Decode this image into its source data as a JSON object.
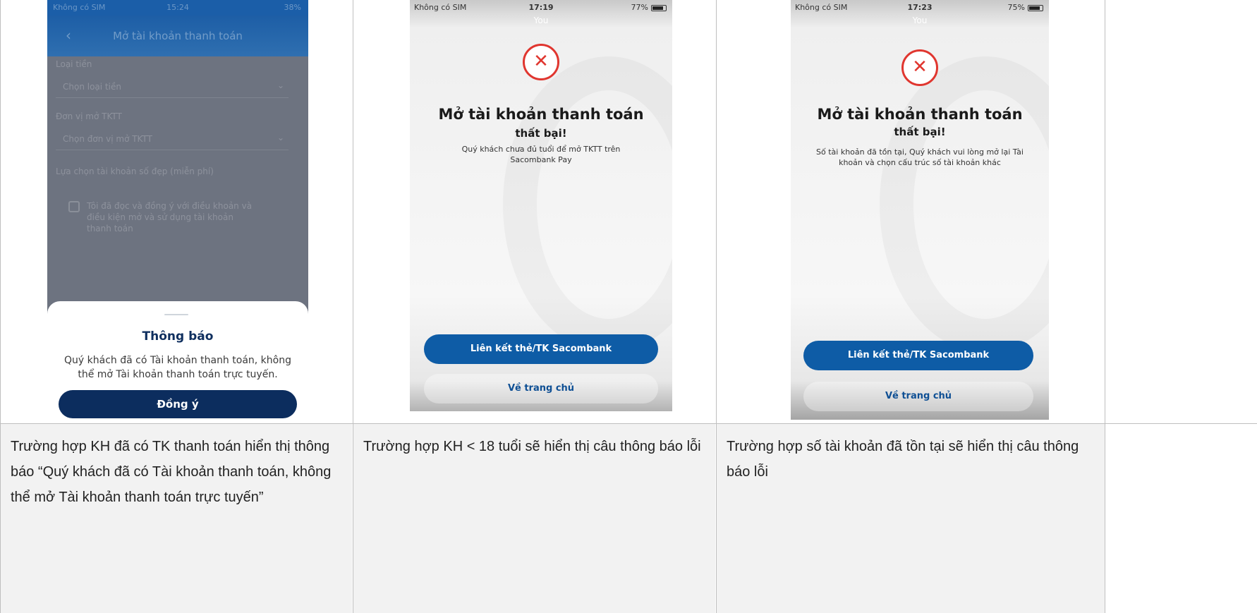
{
  "screen1": {
    "status": {
      "carrier": "Không có SIM",
      "time": "15:24",
      "battery": "38%"
    },
    "header_title": "Mở tài khoản thanh toán",
    "fields": [
      {
        "label": "Loại tiền",
        "value": "Chọn loại tiền"
      },
      {
        "label": "Đơn vị mở TKTT",
        "value": "Chọn đơn vị mở TKTT"
      },
      {
        "label": "Lựa chọn tài khoản số đẹp (miễn phí)",
        "value": ""
      }
    ],
    "agreement": "Tôi đã đọc và đồng ý với điều khoản và điều kiện mở và sử dụng tài khoản thanh toán",
    "dialog": {
      "title": "Thông báo",
      "message": "Quý khách đã có Tài khoản thanh toán, không thể mở Tài khoản thanh toán trực tuyến.",
      "button": "Đồng ý"
    }
  },
  "screen2": {
    "status": {
      "carrier": "Không có SIM",
      "time": "17:19",
      "battery": "77%"
    },
    "top_label": "You",
    "icon": "close-icon",
    "title": "Mở tài khoản thanh toán",
    "subtitle": "thất bại!",
    "message": "Quý khách chưa đủ tuổi để mở TKTT trên Sacombank Pay",
    "primary_button": "Liên kết thẻ/TK Sacombank",
    "secondary_button": "Về trang chủ"
  },
  "screen3": {
    "status": {
      "carrier": "Không có SIM",
      "time": "17:23",
      "battery": "75%"
    },
    "top_label": "You",
    "icon": "close-icon",
    "title": "Mở tài khoản thanh toán",
    "subtitle": "thất bại!",
    "message": "Số tài khoản đã tồn tại, Quý khách vui lòng mở lại Tài khoản và chọn cấu trúc số tài khoản khác",
    "primary_button": "Liên kết thẻ/TK Sacombank",
    "secondary_button": "Về trang chủ"
  },
  "captions": [
    "Trường hợp KH đã có TK thanh toán hiển thị thông báo “Quý khách đã có Tài khoản thanh toán, không thể mở Tài khoản thanh toán trực tuyến”",
    "Trường hợp KH < 18 tuổi sẽ hiển thị câu thông báo lỗi",
    "Trường hợp số tài khoản đã tồn tại sẽ hiển thị câu thông báo lỗi"
  ],
  "colors": {
    "brand_blue": "#0e5ca6",
    "dark_navy": "#0c2d5e",
    "error_red": "#e0362f",
    "caption_bg": "#f2f2f2"
  }
}
